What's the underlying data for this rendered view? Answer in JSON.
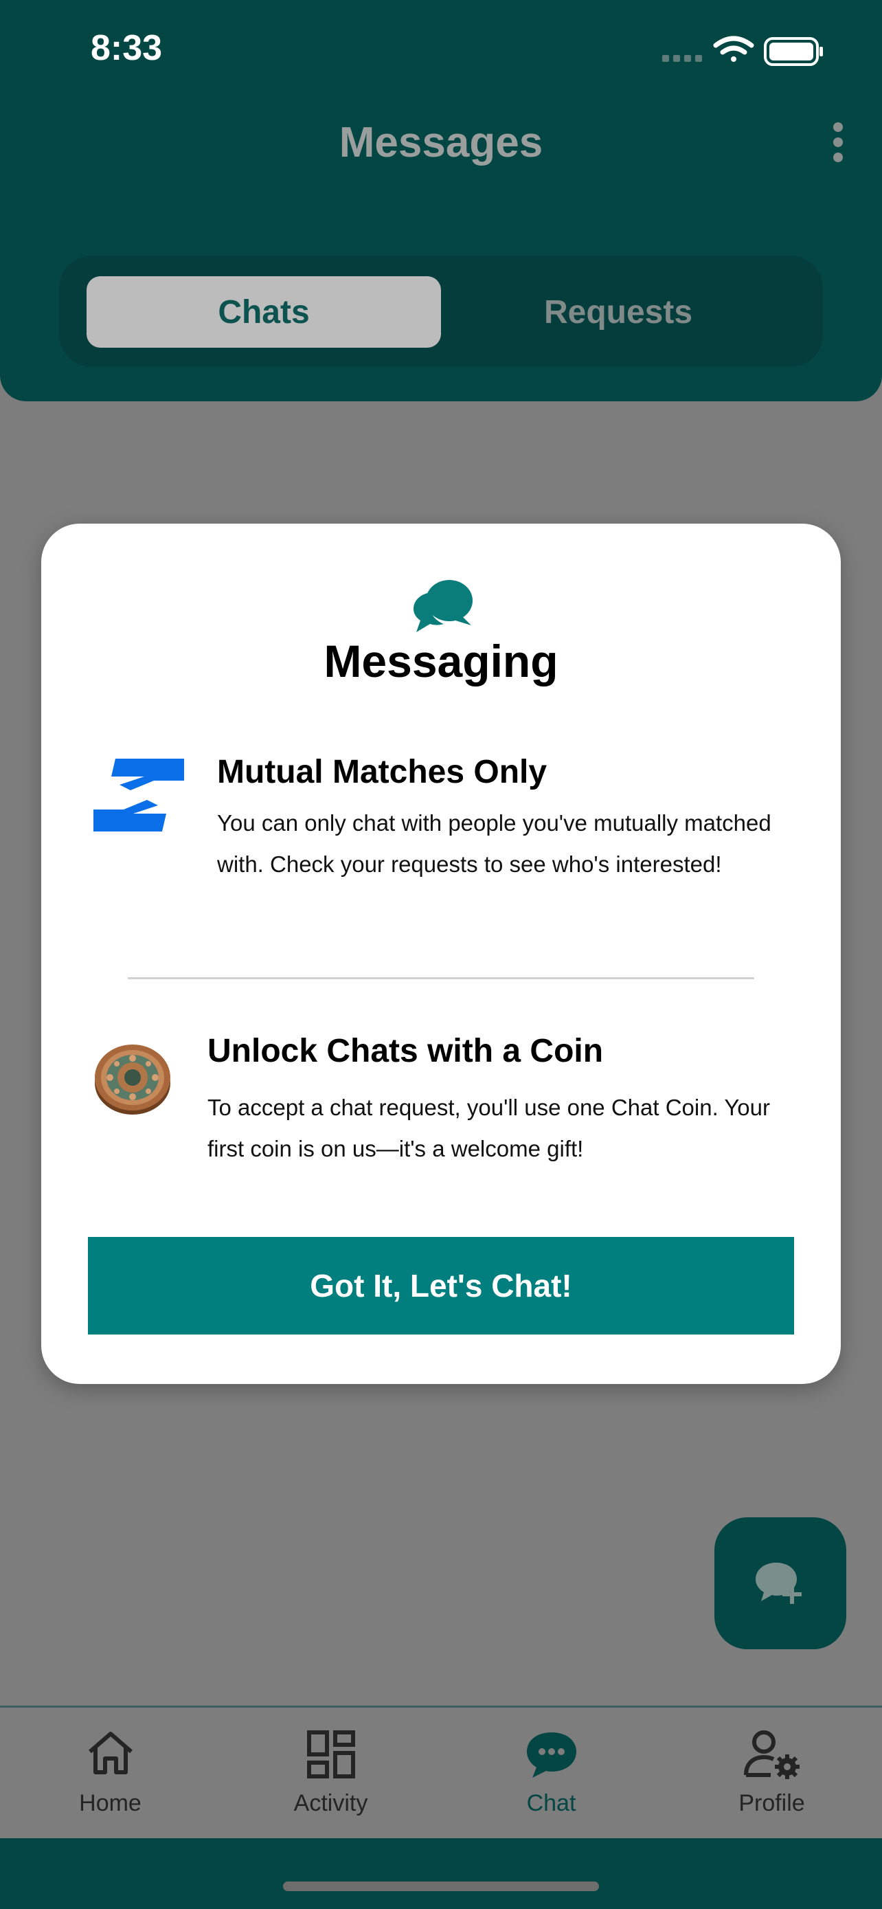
{
  "status_bar": {
    "time": "8:33"
  },
  "header": {
    "title": "Messages",
    "tabs": [
      {
        "label": "Chats",
        "selected": true
      },
      {
        "label": "Requests",
        "selected": false
      }
    ]
  },
  "modal": {
    "icon": "chat-bubbles-icon",
    "title": "Messaging",
    "features": [
      {
        "icon": "helping-hands-icon",
        "title": "Mutual Matches Only",
        "body": "You can only chat with people you've mutually matched with. Check your requests to see who's interested!"
      },
      {
        "icon": "chat-coin-image",
        "title": "Unlock Chats with a Coin",
        "body": "To accept a chat request, you'll use one Chat Coin. Your first coin is on us—it's a welcome gift!"
      }
    ],
    "cta_label": "Got It, Let's Chat!"
  },
  "fab": {
    "icon": "new-chat-icon"
  },
  "bottom_nav": {
    "items": [
      {
        "label": "Home",
        "icon": "home-icon",
        "active": false
      },
      {
        "label": "Activity",
        "icon": "activity-grid-icon",
        "active": false
      },
      {
        "label": "Chat",
        "icon": "chat-icon",
        "active": true
      },
      {
        "label": "Profile",
        "icon": "profile-settings-icon",
        "active": false
      }
    ]
  },
  "colors": {
    "primary": "#034643",
    "accent": "#007f7e",
    "overlay": "#7d7d7d",
    "blue_icon": "#0a6fe8"
  }
}
